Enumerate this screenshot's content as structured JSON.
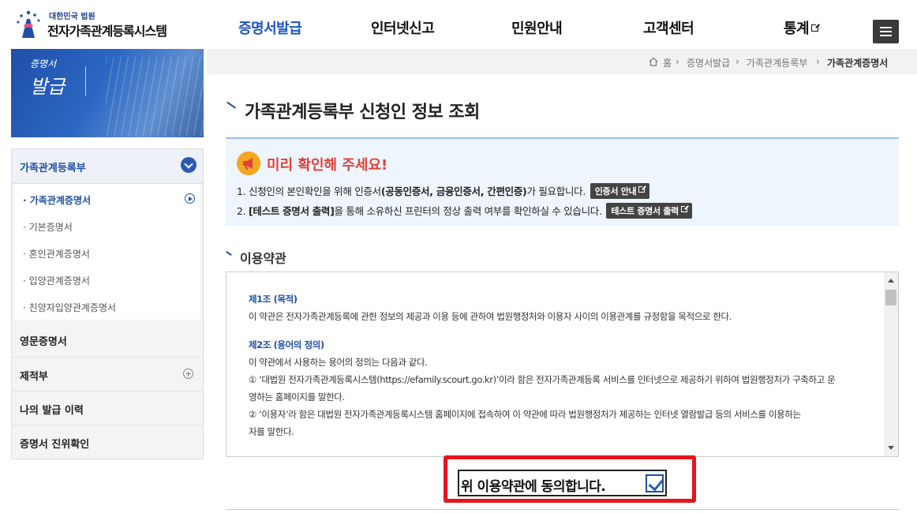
{
  "header": {
    "logo_top": "대한민국 법원",
    "logo_main": "전자가족관계등록시스템",
    "nav": [
      "증명서발급",
      "인터넷신고",
      "민원안내",
      "고객센터",
      "통계"
    ],
    "menu_icon": "hamburger-menu-icon"
  },
  "banner": {
    "small": "증명서",
    "big": "발급"
  },
  "sidebar": {
    "section": "가족관계등록부",
    "sub_items": [
      "가족관계증명서",
      "기본증명서",
      "혼인관계증명서",
      "입양관계증명서",
      "친양자입양관계증명서"
    ],
    "main_items": [
      "영문증명서",
      "제적부",
      "나의 발급 이력",
      "증명서 진위확인"
    ]
  },
  "breadcrumb": [
    "홈",
    "증명서발급",
    "가족관계등록부",
    "가족관계증명서"
  ],
  "page_title": "가족관계등록부 신청인 정보 조회",
  "notice": {
    "title": "미리 확인해 주세요!",
    "line1_a": "1. 신청인의 본인확인을 위해 인증서",
    "line1_b": "(공동인증서, 금융인증서, 간편인증)",
    "line1_c": "가 필요합니다.",
    "btn1": "인증서 안내",
    "line2_a": "2. ",
    "line2_b": "[테스트 증명서 출력]",
    "line2_c": "을 통해 소유하신 프린터의 정상 출력 여부를 확인하실 수 있습니다.",
    "btn2": "테스트 증명서 출력"
  },
  "terms": {
    "section_title": "이용약관",
    "lines": [
      "제1조 (목적)",
      "이 약관은 전자가족관계등록에 관한 정보의 제공과 이용 등에 관하여 법원행정처와 이용자 사이의 이용관계를 규정함을 목적으로 한다.",
      "제2조 (용어의 정의)",
      "이 약관에서 사용하는 용어의 정의는 다음과 같다.",
      "① ‘대법원 전자가족관계등록시스템(https://efamily.scourt.go.kr)’이라 함은 전자가족관계등록 서비스를 인터넷으로 제공하기 위하여 법원행정처가 구축하고 운",
      "영하는 홈페이지를 말한다.",
      "② ‘이용자’라 함은 대법원 전자가족관계등록시스템 홈페이지에 접속하여 이 약관에 따라 법원행정처가 제공하는 인터넷 열람발급 등의 서비스를 이용하는",
      "자를 말한다."
    ]
  },
  "agree": {
    "label": "위 이용약관에 동의합니다.",
    "checked": true
  },
  "colors": {
    "accent": "#1f4fa8",
    "highlight": "#e8141c",
    "notice_title": "#e0433a"
  }
}
